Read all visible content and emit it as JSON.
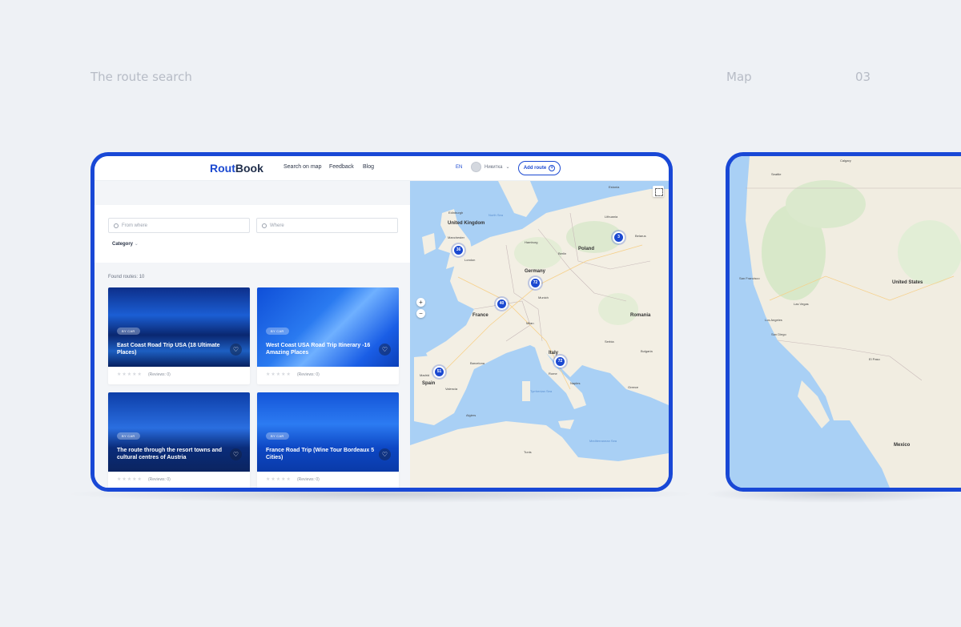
{
  "captions": {
    "left": "The route search",
    "map": "Map",
    "number": "03"
  },
  "header": {
    "logo_part1": "Rout",
    "logo_part2": "Book",
    "nav": [
      "Search on map",
      "Feedback",
      "Blog"
    ],
    "lang": "EN",
    "username": "Никитка",
    "add_route": "Add route"
  },
  "filters": {
    "from_placeholder": "From where",
    "where_placeholder": "Where",
    "category": "Category"
  },
  "found": "Found routes: 10",
  "cards": [
    {
      "badge": "BY CAR",
      "title": "East Coast Road Trip USA (18 Ultimate Places)",
      "reviews": "(Reviews: 0)",
      "rating": 0
    },
    {
      "badge": "BY CAR",
      "title": "West Coast USA Road Trip Itinerary -16 Amazing Places",
      "reviews": "(Reviews: 0)",
      "rating": 0
    },
    {
      "badge": "BY CAR",
      "title": "The route through the resort towns and cultural centres of Austria",
      "reviews": "(Reviews: 0)",
      "rating": 0
    },
    {
      "badge": "BY CAR",
      "title": "France Road Trip (Wine Tour Bordeaux 5 Cities)",
      "reviews": "(Reviews: 0)",
      "rating": 0
    }
  ],
  "map": {
    "zoom_in": "+",
    "zoom_out": "−",
    "clusters": [
      "36",
      "72",
      "40",
      "3",
      "51",
      "72"
    ],
    "countries": [
      "United Kingdom",
      "Germany",
      "Poland",
      "France",
      "Romania",
      "Spain",
      "Italy",
      "Lithuania",
      "Estonia",
      "Belarus"
    ],
    "cities": [
      "Edinburgh",
      "Manchester",
      "London",
      "Hamburg",
      "Berlin",
      "Munich",
      "Milan",
      "Madrid",
      "Valencia",
      "Rome",
      "Naples",
      "Barcelona",
      "Tunis",
      "Algiers",
      "Greece",
      "Bulgaria",
      "Serbia"
    ],
    "seas": [
      "Mediterranean Sea",
      "North Sea",
      "Tyrrhenian Sea"
    ]
  },
  "side_map": {
    "countries": [
      "United States",
      "Mexico"
    ],
    "cities": [
      "San Francisco",
      "Las Vegas",
      "Los Angeles",
      "San Diego",
      "El Paso",
      "Calgary",
      "Seattle"
    ]
  }
}
